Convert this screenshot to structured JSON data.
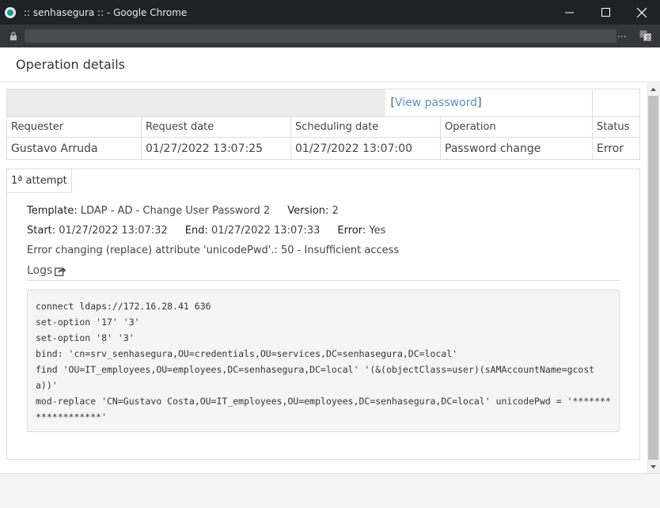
{
  "window": {
    "title": ":: senhasegura :: - Google Chrome",
    "minimize": "—",
    "maximize": "☐",
    "close": "✕"
  },
  "addressbar": {
    "overflow": "..."
  },
  "page": {
    "title": "Operation details"
  },
  "operation": {
    "view_password_open": "[",
    "view_password_label": "View password",
    "view_password_close": "]",
    "headers": [
      "Requester",
      "Request date",
      "Scheduling date",
      "Operation",
      "Status"
    ],
    "row": [
      "Gustavo Arruda",
      "01/27/2022 13:07:25",
      "01/27/2022 13:07:00",
      "Password change",
      "Error"
    ]
  },
  "attempt": {
    "tab_label": "1ª attempt",
    "template_label": "Template:",
    "template_value": "LDAP - AD - Change User Password 2",
    "version_label": "Version:",
    "version_value": "2",
    "start_label": "Start:",
    "start_value": "01/27/2022 13:07:32",
    "end_label": "End:",
    "end_value": "01/27/2022 13:07:33",
    "error_label": "Error:",
    "error_value": "Yes",
    "message": "Error changing (replace) attribute 'unicodePwd'.: 50 - Insufficient access",
    "logs_label": "Logs",
    "log_lines": [
      "connect ldaps://172.16.28.41 636",
      "set-option '17' '3'",
      "set-option '8' '3'",
      "bind: 'cn=srv_senhasegura,OU=credentials,OU=services,DC=senhasegura,DC=local'",
      "find 'OU=IT_employees,OU=employees,DC=senhasegura,DC=local' '(&(objectClass=user)(sAMAccountName=gcosta))'",
      "mod-replace 'CN=Gustavo Costa,OU=IT_employees,OU=employees,DC=senhasegura,DC=local' unicodePwd = '*******************'"
    ]
  },
  "colors": {
    "error": "#e60000",
    "link": "#5a8dc4",
    "titlebar": "#202124"
  }
}
